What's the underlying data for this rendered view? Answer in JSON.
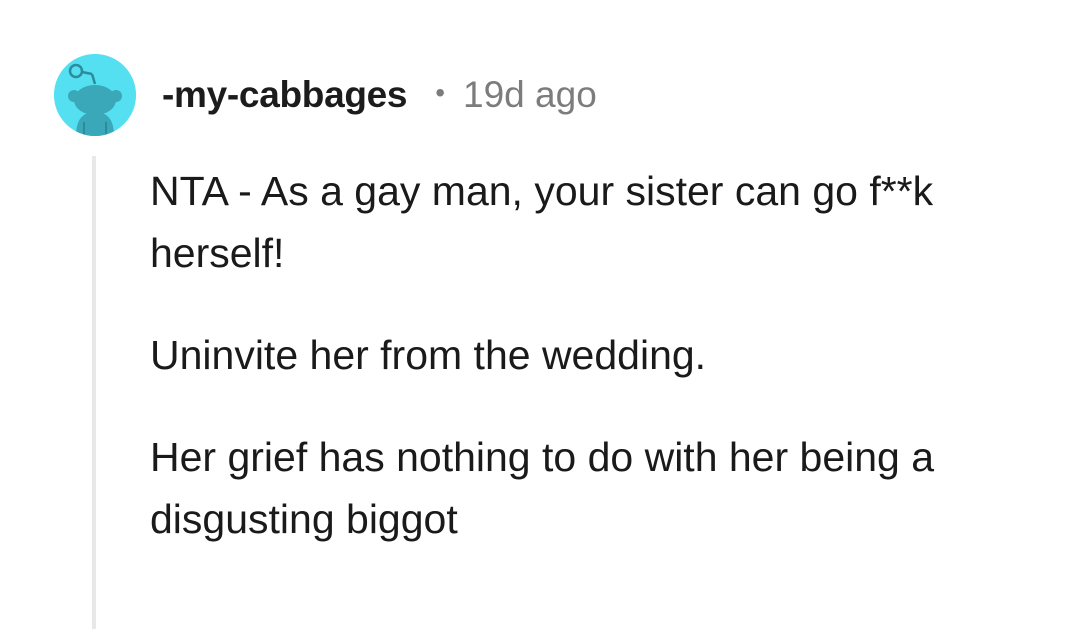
{
  "comment": {
    "author": "-my-cabbages",
    "separator": "•",
    "timestamp": "19d ago",
    "avatar_icon": "snoo-avatar-icon",
    "avatar_bg": "#54e0f0",
    "paragraphs": [
      "NTA - As a gay man, your sister can go f**k herself!",
      "Uninvite her from the wedding.",
      "Her grief has nothing to do with her being a disgusting biggot"
    ]
  }
}
